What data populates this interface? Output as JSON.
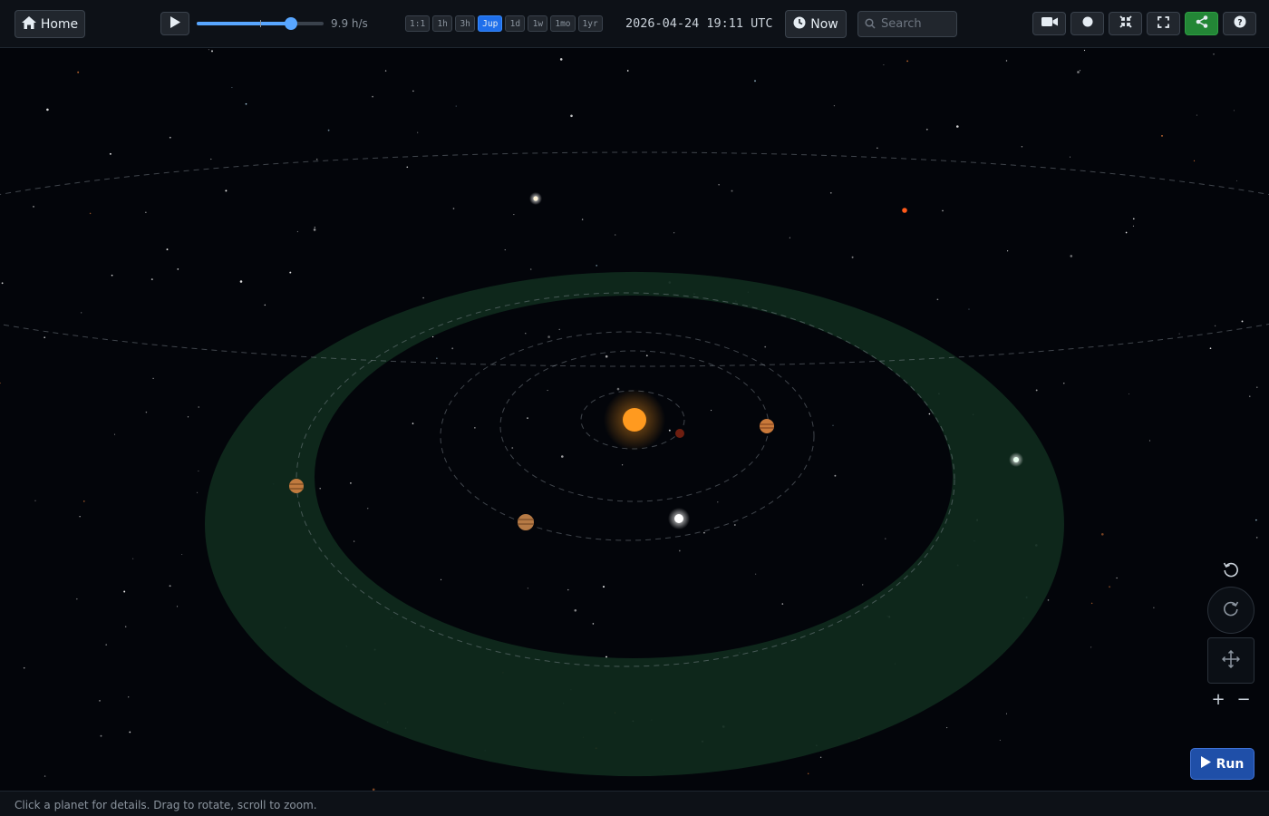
{
  "toolbar": {
    "home_label": "Home",
    "speed_label": "9.9 h/s",
    "speed_slider_value": 0.74,
    "presets": [
      "1:1",
      "1h",
      "3h",
      "Jup",
      "1d",
      "1w",
      "1mo",
      "1yr"
    ],
    "active_preset": "Jup",
    "datetime": "2026-04-24 19:11 UTC",
    "now_label": "Now",
    "search_placeholder": "Search",
    "tools": [
      "video-camera-icon",
      "record-icon",
      "compress-icon",
      "fullscreen-icon",
      "share-icon",
      "help-icon"
    ]
  },
  "controls": {
    "zoom_in": "+",
    "zoom_out": "−",
    "run_label": "Run"
  },
  "status": {
    "hint": "Click a planet for details. Drag to rotate, scroll to zoom."
  },
  "colors": {
    "habitable_zone": "#0f2a1d",
    "sun": "#ff9a1f",
    "active_preset": "#1f6feb",
    "share_button": "#238636",
    "run_button": "#1f4fa8"
  }
}
